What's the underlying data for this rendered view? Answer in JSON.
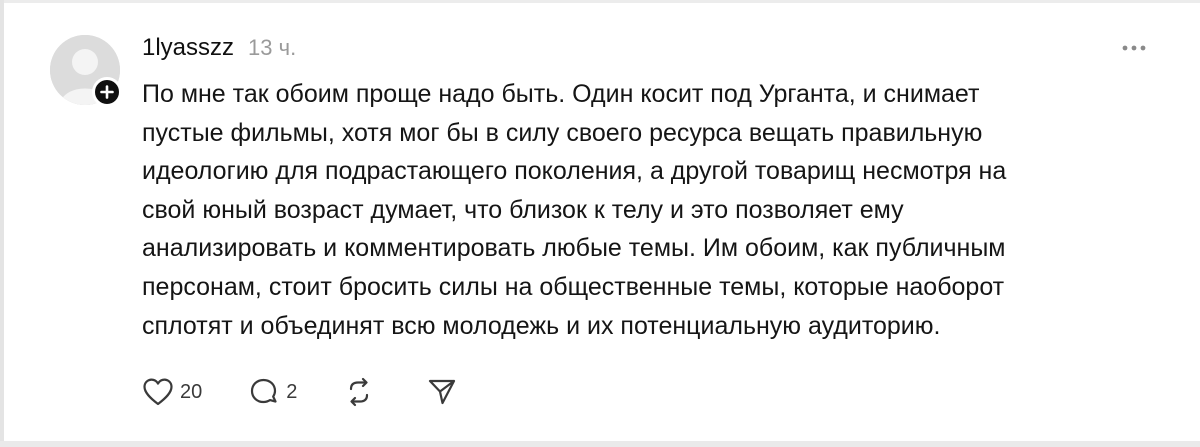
{
  "post": {
    "username": "1lyasszz",
    "timestamp": "13 ч.",
    "text": "По мне так обоим проще надо быть. Один косит под Урганта, и снимает\nпустые фильмы, хотя мог бы в силу своего ресурса вещать правильную\nидеологию для подрастающего поколения, а другой товарищ несмотря на\nсвой юный возраст думает, что близок к телу и это позволяет ему\nанализировать и комментировать любые темы. Им обоим, как публичным\nперсонам, стоит бросить силы на общественные темы, которые наоборот\nсплотят и объединят всю молодежь и их потенциальную аудиторию.",
    "avatar_icon": "default-avatar-icon",
    "follow_icon": "plus-icon",
    "more_icon": "more-horizontal-icon"
  },
  "actions": {
    "like": {
      "icon": "heart-icon",
      "count": "20"
    },
    "reply": {
      "icon": "comment-icon",
      "count": "2"
    },
    "repost": {
      "icon": "repost-icon"
    },
    "share": {
      "icon": "send-icon"
    }
  },
  "colors": {
    "text": "#151515",
    "muted": "#9a9a9a",
    "icon": "#3a3a3a",
    "badge": "#101010",
    "avatar_bg": "#dcdcdc"
  }
}
